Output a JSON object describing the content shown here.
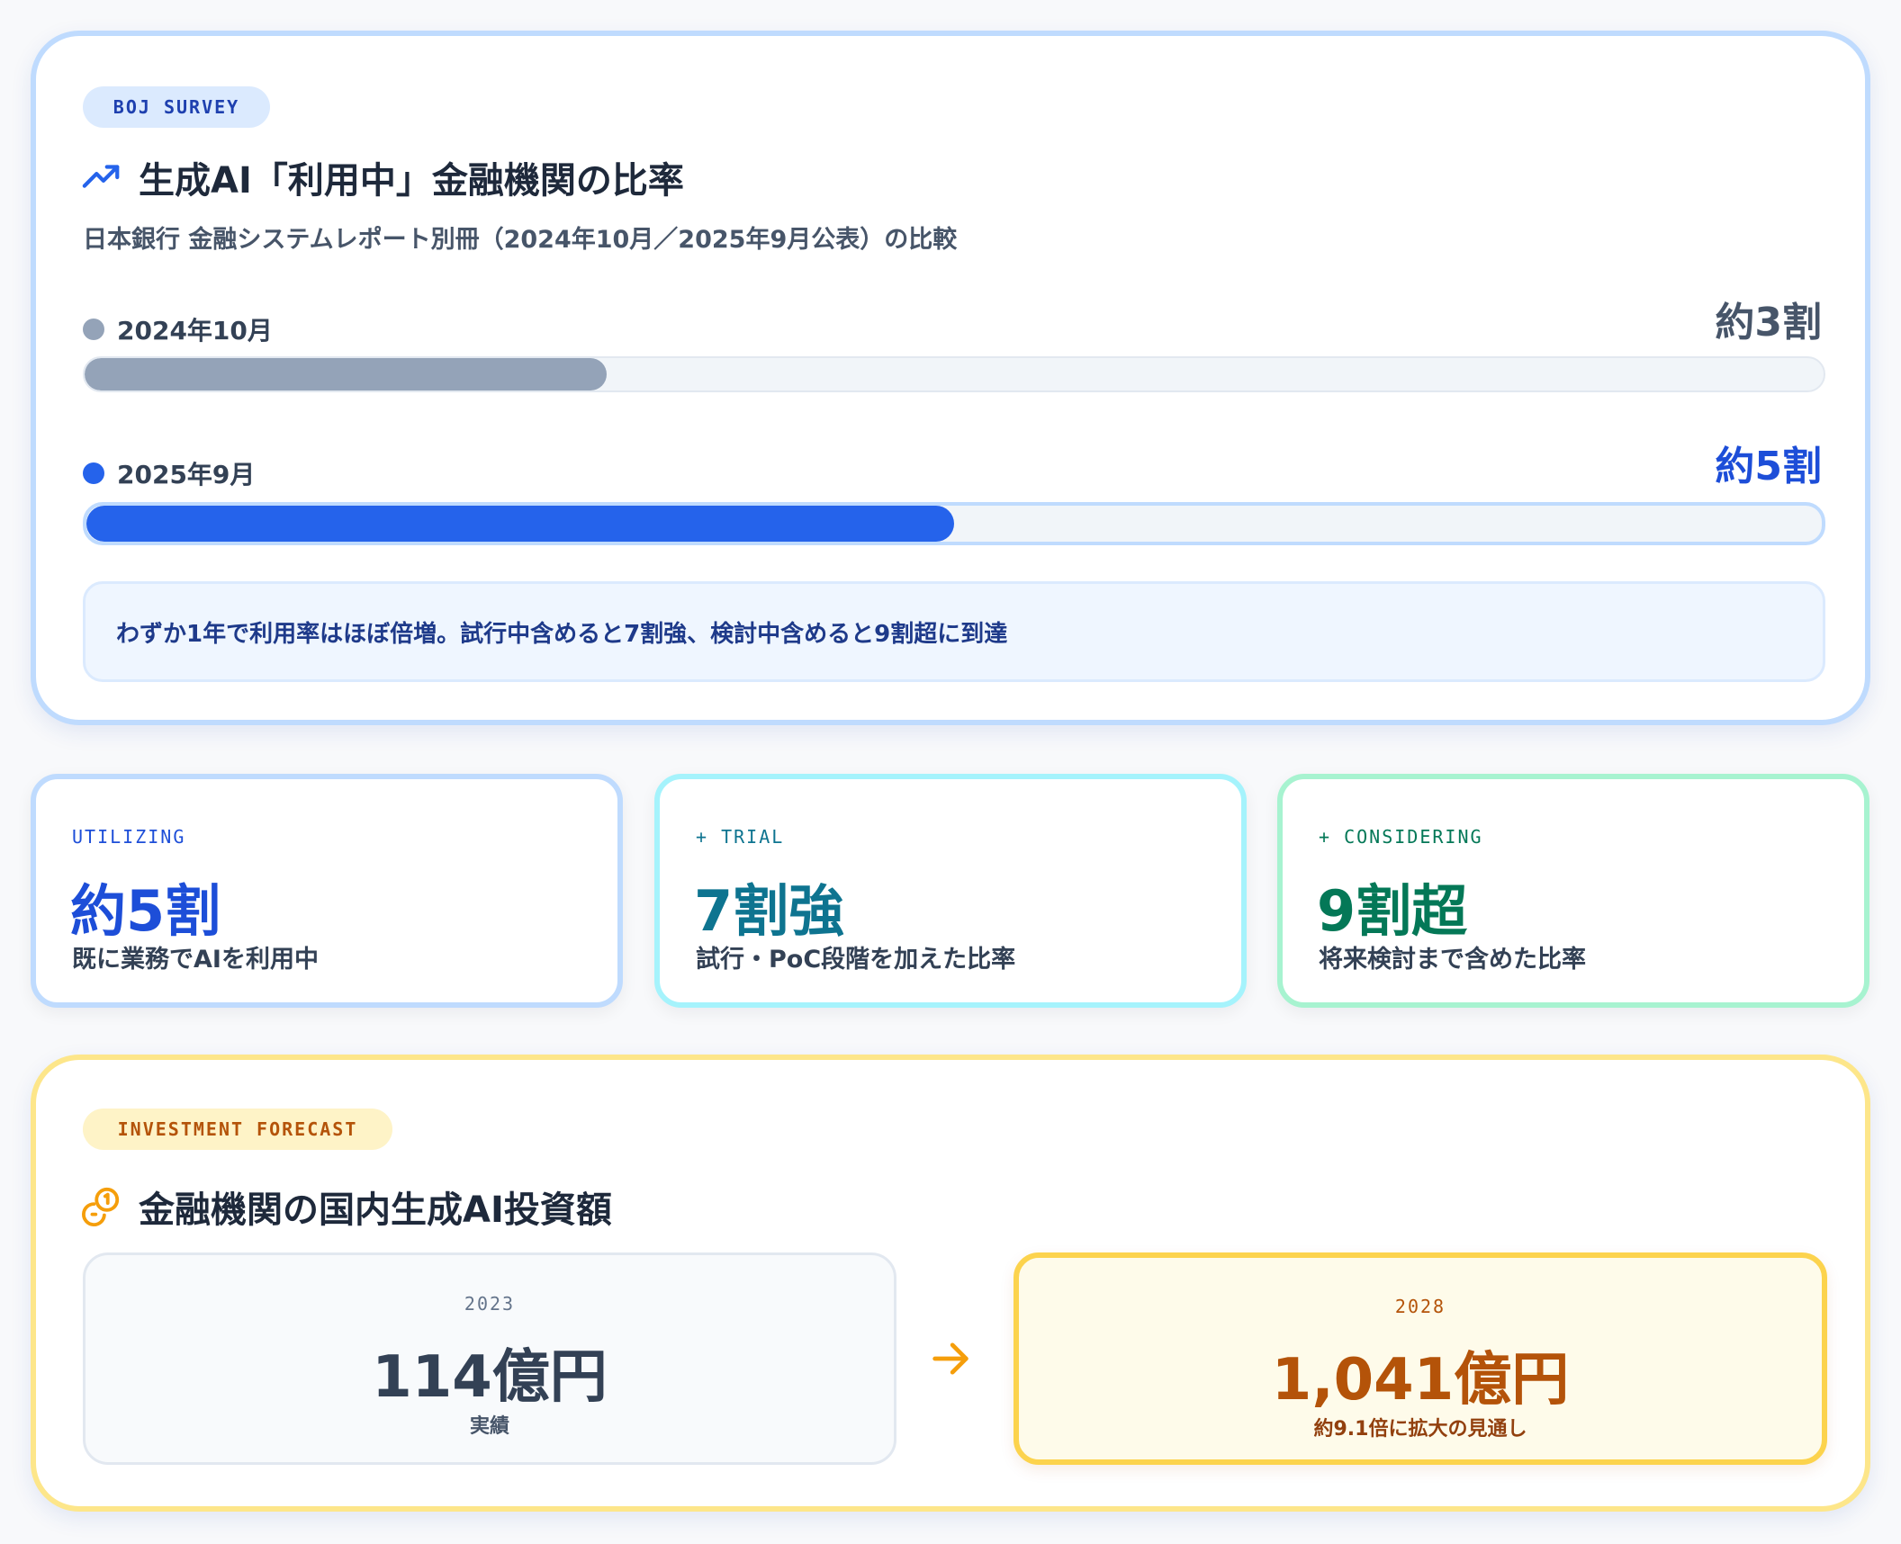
{
  "survey": {
    "badge": "BOJ SURVEY",
    "title": "生成AI「利用中」金融機関の比率",
    "subtitle": "日本銀行 金融システムレポート別冊（2024年10月／2025年9月公表）の比較",
    "rows": [
      {
        "label": "2024年10月",
        "value": "約3割",
        "fraction": 0.3,
        "color": "#94a3b8",
        "value_color": "#475569"
      },
      {
        "label": "2025年9月",
        "value": "約5割",
        "fraction": 0.5,
        "color": "#2563eb",
        "value_color": "#1d4ed8"
      }
    ],
    "note": "わずか1年で利用率はほぼ倍増。試行中含めると7割強、検討中含めると9割超に到達"
  },
  "stats": [
    {
      "kicker": "UTILIZING",
      "value": "約5割",
      "desc": "既に業務でAIを利用中",
      "color": "#1d4ed8"
    },
    {
      "kicker": "+ TRIAL",
      "value": "7割強",
      "desc": "試行・PoC段階を加えた比率",
      "color": "#0e7490"
    },
    {
      "kicker": "+ CONSIDERING",
      "value": "9割超",
      "desc": "将来検討まで含めた比率",
      "color": "#047857"
    }
  ],
  "forecast": {
    "badge": "INVESTMENT FORECAST",
    "title": "金融機関の国内生成AI投資額",
    "before": {
      "year": "2023",
      "amount": "114億円",
      "caption": "実績"
    },
    "after": {
      "year": "2028",
      "amount": "1,041億円",
      "caption": "約9.1倍に拡大の見通し"
    }
  },
  "icons": {
    "survey_title_icon": "trending-up-icon",
    "forecast_title_icon": "coins-icon",
    "forecast_arrow": "arrow-right-icon"
  },
  "colors": {
    "survey_border": "#bfdbfe",
    "forecast_border": "#fde68a",
    "amber_text": "#b45309",
    "accent_blue": "#2563eb"
  }
}
